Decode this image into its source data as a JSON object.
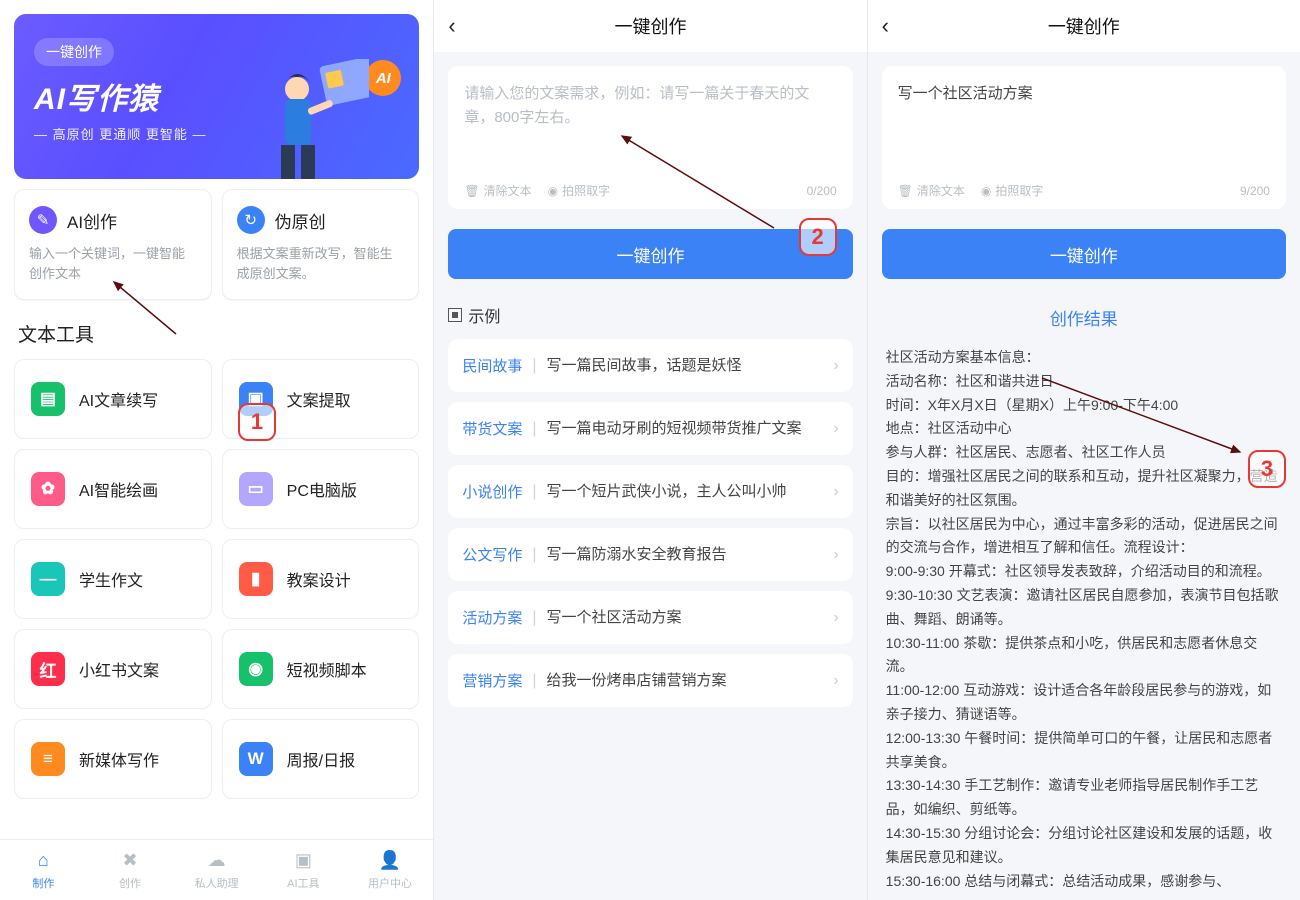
{
  "pane1": {
    "hero": {
      "pill": "一键创作",
      "title": "AI写作猿",
      "subtitle": "— 高原创 更通顺 更智能 —",
      "badge": "AI"
    },
    "cards": [
      {
        "name": "AI创作",
        "desc": "输入一个关键词，一键智能创作文本"
      },
      {
        "name": "伪原创",
        "desc": "根据文案重新改写，智能生成原创文案。"
      }
    ],
    "section": "文本工具",
    "tools": [
      {
        "label": "AI文章续写",
        "color": "#17c06b",
        "glyph": "▤"
      },
      {
        "label": "文案提取",
        "color": "#3b82f6",
        "glyph": "▣"
      },
      {
        "label": "AI智能绘画",
        "color": "#ff5b8a",
        "glyph": "✿"
      },
      {
        "label": "PC电脑版",
        "color": "#b2a6ff",
        "glyph": "▭"
      },
      {
        "label": "学生作文",
        "color": "#19c6b8",
        "glyph": "—"
      },
      {
        "label": "教案设计",
        "color": "#ff5b47",
        "glyph": "▮"
      },
      {
        "label": "小红书文案",
        "color": "#ff2e4d",
        "glyph": "红"
      },
      {
        "label": "短视频脚本",
        "color": "#17c06b",
        "glyph": "◉"
      },
      {
        "label": "新媒体写作",
        "color": "#ff8a1f",
        "glyph": "≡"
      },
      {
        "label": "周报/日报",
        "color": "#3b82f6",
        "glyph": "W"
      }
    ],
    "tabs": [
      {
        "label": "制作",
        "icon": "⌂",
        "active": true
      },
      {
        "label": "创作",
        "icon": "✖"
      },
      {
        "label": "私人助理",
        "icon": "☁"
      },
      {
        "label": "AI工具",
        "icon": "▣"
      },
      {
        "label": "用户中心",
        "icon": "👤"
      }
    ]
  },
  "pane2": {
    "title": "一键创作",
    "placeholder": "请输入您的文案需求，例如：请写一篇关于春天的文章，800字左右。",
    "clear": "清除文本",
    "photo": "拍照取字",
    "count": "0/200",
    "button": "一键创作",
    "examples_title": "示例",
    "examples": [
      {
        "tag": "民间故事",
        "text": "写一篇民间故事，话题是妖怪"
      },
      {
        "tag": "带货文案",
        "text": "写一篇电动牙刷的短视频带货推广文案"
      },
      {
        "tag": "小说创作",
        "text": "写一个短片武侠小说，主人公叫小帅"
      },
      {
        "tag": "公文写作",
        "text": "写一篇防溺水安全教育报告"
      },
      {
        "tag": "活动方案",
        "text": "写一个社区活动方案"
      },
      {
        "tag": "营销方案",
        "text": "给我一份烤串店铺营销方案"
      }
    ],
    "callout": "2"
  },
  "pane3": {
    "title": "一键创作",
    "value": "写一个社区活动方案",
    "clear": "清除文本",
    "photo": "拍照取字",
    "count": "9/200",
    "button": "一键创作",
    "result_title": "创作结果",
    "result_body": "社区活动方案基本信息：\n活动名称：社区和谐共进日\n时间：X年X月X日（星期X）上午9:00-下午4:00\n地点：社区活动中心\n参与人群：社区居民、志愿者、社区工作人员\n目的：增强社区居民之间的联系和互动，提升社区凝聚力，营造和谐美好的社区氛围。\n宗旨：以社区居民为中心，通过丰富多彩的活动，促进居民之间的交流与合作，增进相互了解和信任。流程设计：\n9:00-9:30 开幕式：社区领导发表致辞，介绍活动目的和流程。\n9:30-10:30 文艺表演：邀请社区居民自愿参加，表演节目包括歌曲、舞蹈、朗诵等。\n10:30-11:00 茶歇：提供茶点和小吃，供居民和志愿者休息交流。\n11:00-12:00 互动游戏：设计适合各年龄段居民参与的游戏，如亲子接力、猜谜语等。\n12:00-13:30 午餐时间：提供简单可口的午餐，让居民和志愿者共享美食。\n13:30-14:30 手工艺制作：邀请专业老师指导居民制作手工艺品，如编织、剪纸等。\n14:30-15:30 分组讨论会：分组讨论社区建设和发展的话题，收集居民意见和建议。\n15:30-16:00 总结与闭幕式：总结活动成果，感谢参与、",
    "callout": "3"
  },
  "callout1": "1"
}
